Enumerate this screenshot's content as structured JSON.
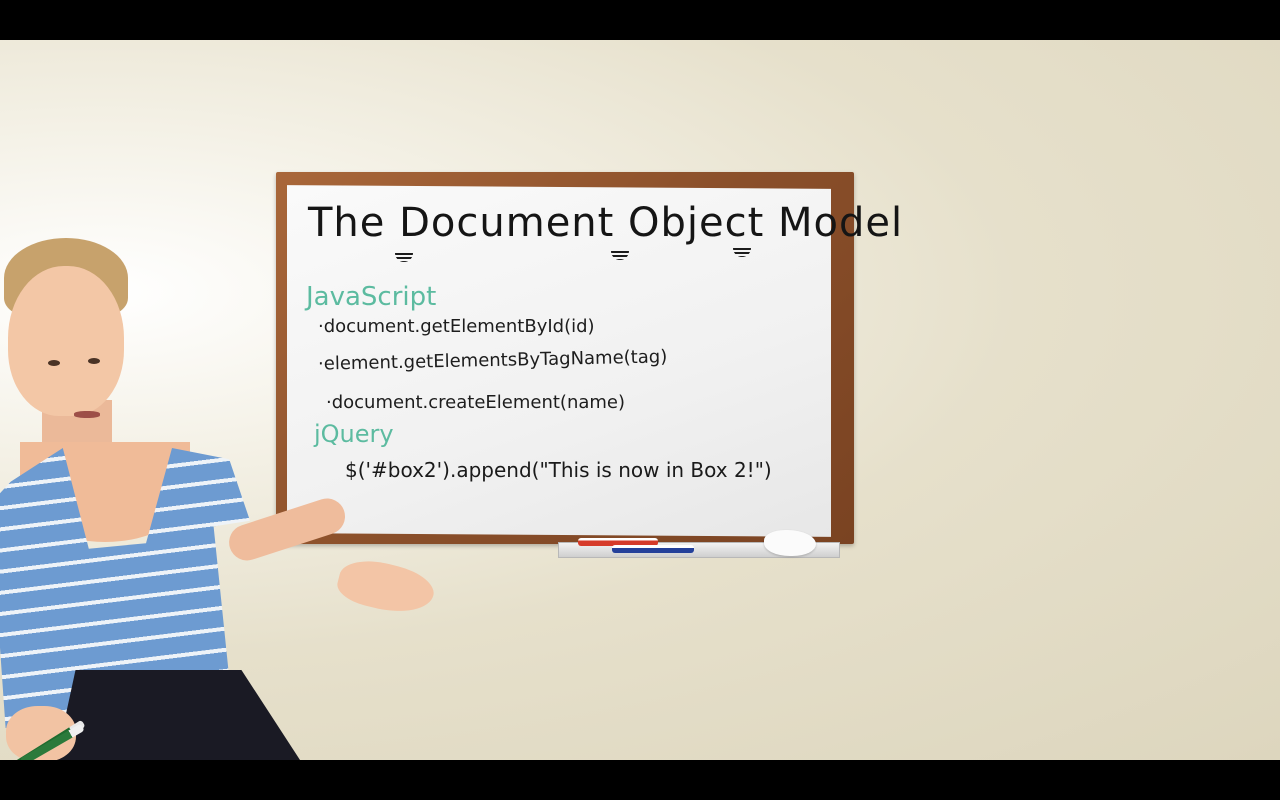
{
  "whiteboard": {
    "title": "The Document Object Model",
    "javascript_heading": "JavaScript",
    "javascript_items": [
      "·document.getElementById(id)",
      "·element.getElementsByTagName(tag)",
      "·document.createElement(name)"
    ],
    "jquery_heading": "jQuery",
    "jquery_code": "$('#box2').append(\"This is now in Box 2!\")"
  },
  "colors": {
    "heading_teal": "#5cbba0",
    "board_frame": "#8a4f2a",
    "wall": "#e6e0cb",
    "shirt_blue": "#6d9bd1",
    "marker_red": "#d63b2a",
    "marker_blue": "#24409a",
    "marker_green": "#1f6b2f"
  }
}
